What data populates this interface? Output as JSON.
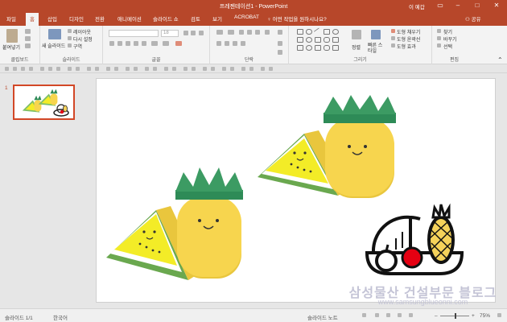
{
  "app": {
    "title": "프레젠테이션1 - PowerPoint",
    "user": "이 예갑"
  },
  "tabs": [
    "파일",
    "홈",
    "삽입",
    "디자인",
    "전환",
    "애니메이션",
    "슬라이드 쇼",
    "검토",
    "보기",
    "ACROBAT"
  ],
  "active_tab": "홈",
  "tell_me": "어떤 작업을 원하시나요?",
  "share_label": "공유",
  "ribbon": {
    "clipboard": {
      "paste": "붙여넣기",
      "label": "클립보드"
    },
    "slides": {
      "new_slide": "새 슬라이드",
      "layout": "레이아웃",
      "reset": "다시 설정",
      "section": "구역",
      "label": "슬라이드"
    },
    "font": {
      "size": "18",
      "label": "글꼴"
    },
    "paragraph": {
      "label": "단락"
    },
    "drawing": {
      "arrange": "정렬",
      "quick_styles": "빠른 스타일",
      "fill": "도형 채우기",
      "outline": "도형 윤곽선",
      "effects": "도형 효과",
      "label": "그리기"
    },
    "editing": {
      "find": "찾기",
      "replace": "바꾸기",
      "select": "선택",
      "label": "편집"
    }
  },
  "thumbnails": {
    "slide_number": "1"
  },
  "status": {
    "slide_info": "슬라이드 1/1",
    "language": "한국어",
    "notes": "슬라이드 노트",
    "zoom": "75%"
  },
  "watermark": {
    "text": "삼성물산 건설부문 블로그",
    "url": "www.samsungblueonni.com"
  },
  "colors": {
    "accent": "#b7472a",
    "pineapple_body": "#f7d54e",
    "pineapple_leaf": "#2e8b57",
    "melon_rind": "#7fbf6a",
    "melon_flesh": "#f3ec27"
  },
  "icons": [
    "paste-icon",
    "new-slide-icon",
    "shape-gallery-icon",
    "find-icon",
    "replace-icon",
    "select-icon",
    "fruit-bowl-icon",
    "share-icon",
    "lightbulb-icon"
  ]
}
